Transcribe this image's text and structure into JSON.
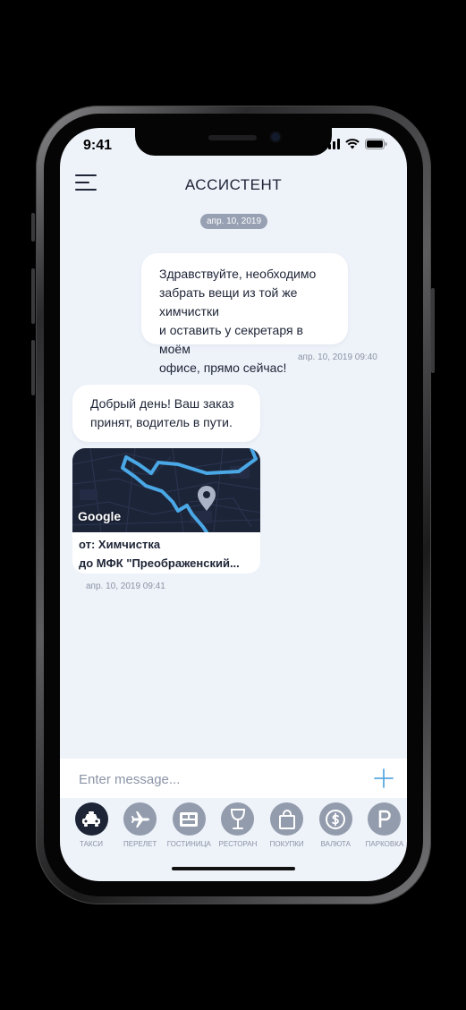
{
  "status_bar": {
    "time": "9:41"
  },
  "header": {
    "title": "АССИСТЕНТ"
  },
  "chat": {
    "date_divider": "апр. 10, 2019",
    "messages": [
      {
        "direction": "outgoing",
        "lines": [
          "Здравствуйте, необходимо",
          "забрать вещи из той же химчистки",
          "и оставить у секретаря в моём",
          "офисе, прямо сейчас!"
        ],
        "timestamp": "апр. 10, 2019 09:40"
      },
      {
        "direction": "incoming",
        "lines": [
          "Добрый день! Ваш заказ",
          "принят, водитель в пути."
        ]
      }
    ],
    "route_card": {
      "map_provider": "Google",
      "from_line": "от:  Химчистка",
      "to_line": "до МФК \"Преображенский...",
      "timestamp": "апр. 10, 2019 09:41"
    }
  },
  "composer": {
    "placeholder": "Enter message..."
  },
  "categories": [
    {
      "label": "ТАКСИ",
      "icon": "taxi-icon",
      "active": true
    },
    {
      "label": "ПЕРЕЛЕТ",
      "icon": "airplane-icon",
      "active": false
    },
    {
      "label": "ГОСТИНИЦА",
      "icon": "hotel-icon",
      "active": false
    },
    {
      "label": "РЕСТОРАН",
      "icon": "wine-glass-icon",
      "active": false
    },
    {
      "label": "ПОКУПКИ",
      "icon": "shopping-bag-icon",
      "active": false
    },
    {
      "label": "ВАЛЮТА",
      "icon": "currency-icon",
      "active": false
    },
    {
      "label": "ПАРКОВКА",
      "icon": "parking-icon",
      "active": false
    }
  ],
  "colors": {
    "background": "#eef2f9",
    "bubble": "#ffffff",
    "text": "#1d2436",
    "muted": "#8b94a6",
    "accent": "#5aa8df",
    "category_inactive": "#939cad",
    "category_active": "#1d2436",
    "map_dark": "#1c2438",
    "map_route": "#4aa8e6"
  }
}
